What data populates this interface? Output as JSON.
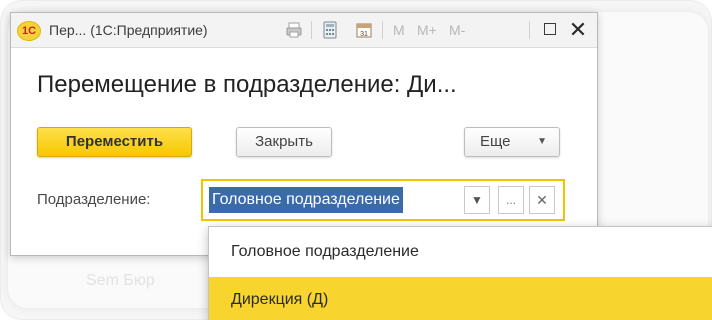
{
  "window": {
    "app_logo_text": "1С",
    "title": "Пер... (1С:Предприятие)",
    "toolbar_m_labels": [
      "M",
      "M+",
      "M-"
    ]
  },
  "form": {
    "title": "Перемещение в подразделение: Ди...",
    "move_button": "Переместить",
    "close_button": "Закрыть",
    "more_button": "Еще",
    "department_label": "Подразделение:",
    "department_value": "Головное подразделение",
    "select_button": "..."
  },
  "dropdown": {
    "items": [
      "Головное подразделение",
      "Дирекция (Д)"
    ],
    "highlighted_index": 1
  },
  "background": {
    "ghost_text": "Sem Бюр"
  },
  "colors": {
    "accent_yellow": "#f6c800",
    "selection_blue": "#3b6aa9",
    "highlight_yellow": "#f8d42e"
  },
  "icons": [
    "logo-1c-icon",
    "print-icon",
    "calculator-icon",
    "calendar-icon",
    "maximize-icon",
    "close-icon",
    "chevron-down-icon",
    "clear-icon"
  ]
}
